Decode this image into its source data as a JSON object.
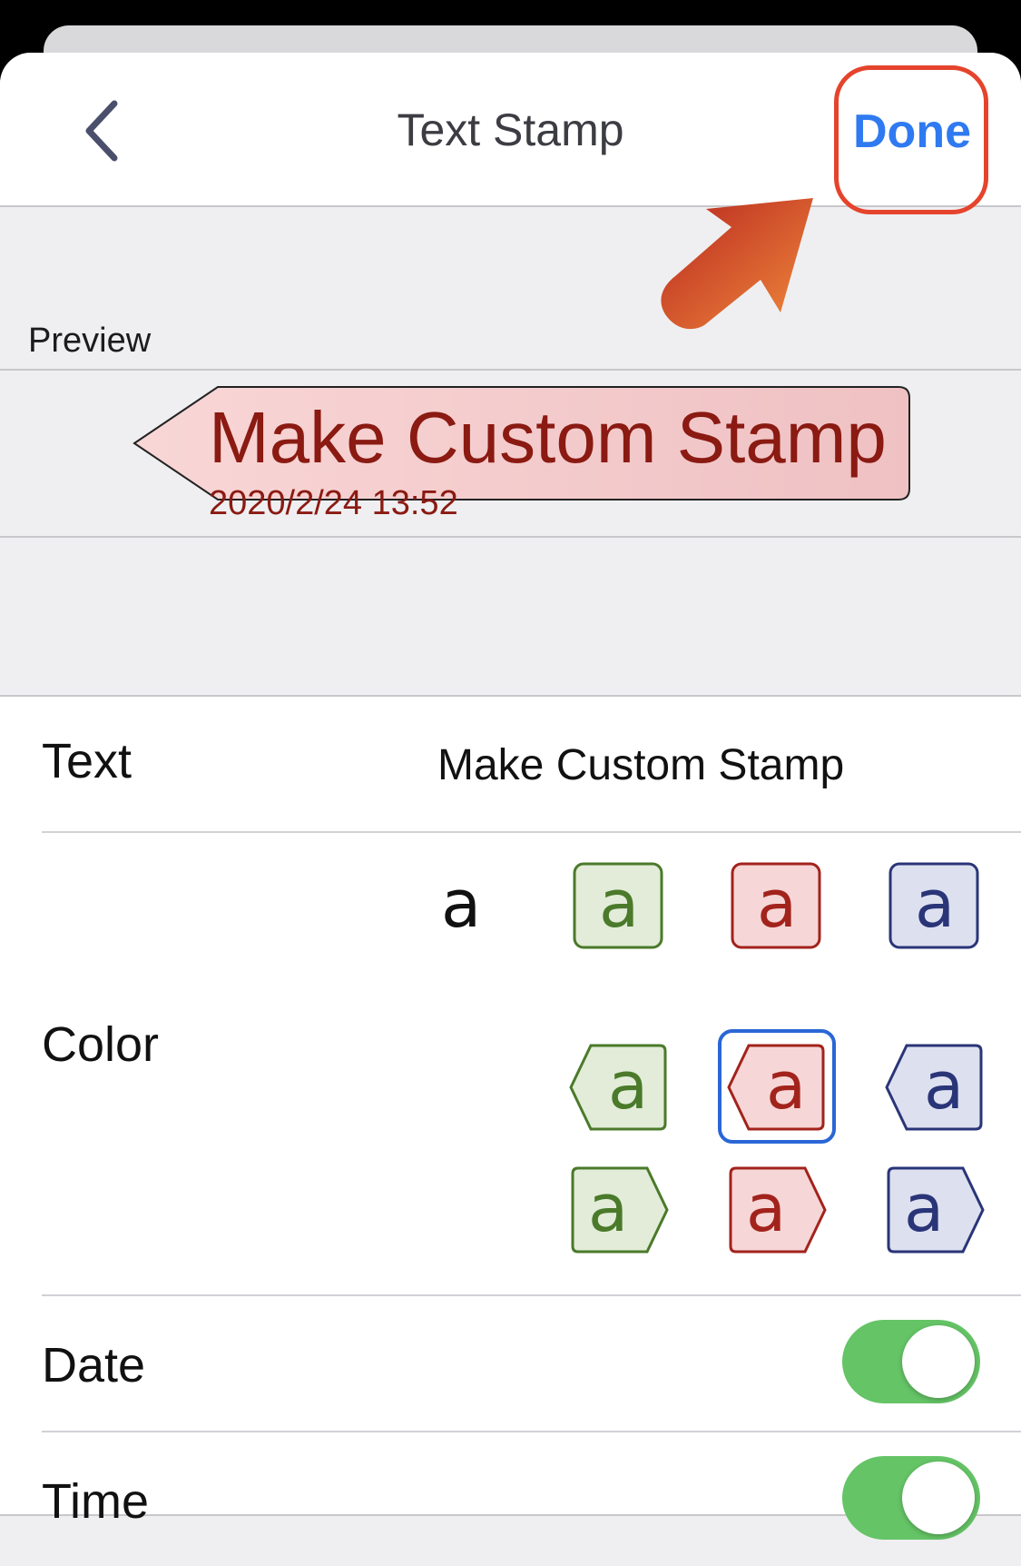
{
  "nav": {
    "title": "Text Stamp",
    "done_label": "Done"
  },
  "preview": {
    "label": "Preview",
    "stamp_text": "Make Custom Stamp",
    "stamp_datetime": "2020/2/24 13:52"
  },
  "settings": {
    "text_label": "Text",
    "text_value": "Make Custom Stamp",
    "color_label": "Color",
    "date_label": "Date",
    "date_on": true,
    "time_label": "Time",
    "time_on": true
  },
  "color_options": {
    "glyph": "a",
    "selected": "red-left-arrow",
    "colors": {
      "green": "#4a7a2a",
      "red": "#a2231c",
      "blue": "#2a3578",
      "black": "#111111"
    }
  },
  "colors": {
    "accent": "#2f7af0",
    "toggle_on": "#65c466",
    "annotation": "#e5442c"
  }
}
